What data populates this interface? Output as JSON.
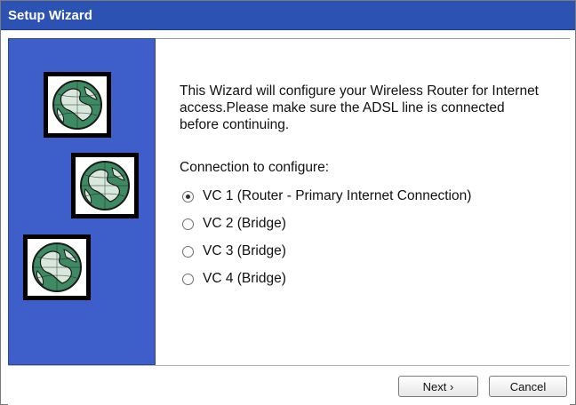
{
  "window": {
    "title": "Setup Wizard"
  },
  "sidebar": {
    "icons": [
      "globe-icon",
      "globe-icon",
      "globe-icon"
    ],
    "background_color": "#3e5fc9"
  },
  "content": {
    "intro": "This Wizard will configure your Wireless Router for Internet access.Please make sure the ADSL line is connected before continuing.",
    "connection_label": "Connection to configure:",
    "options": [
      {
        "label": "VC 1 (Router - Primary Internet Connection)",
        "selected": true
      },
      {
        "label": "VC 2 (Bridge)",
        "selected": false
      },
      {
        "label": "VC 3 (Bridge)",
        "selected": false
      },
      {
        "label": "VC 4 (Bridge)",
        "selected": false
      }
    ]
  },
  "footer": {
    "next_label": "Next ›",
    "cancel_label": "Cancel"
  },
  "colors": {
    "titlebar": "#2c52b4",
    "sidebar": "#3e5fc9"
  }
}
